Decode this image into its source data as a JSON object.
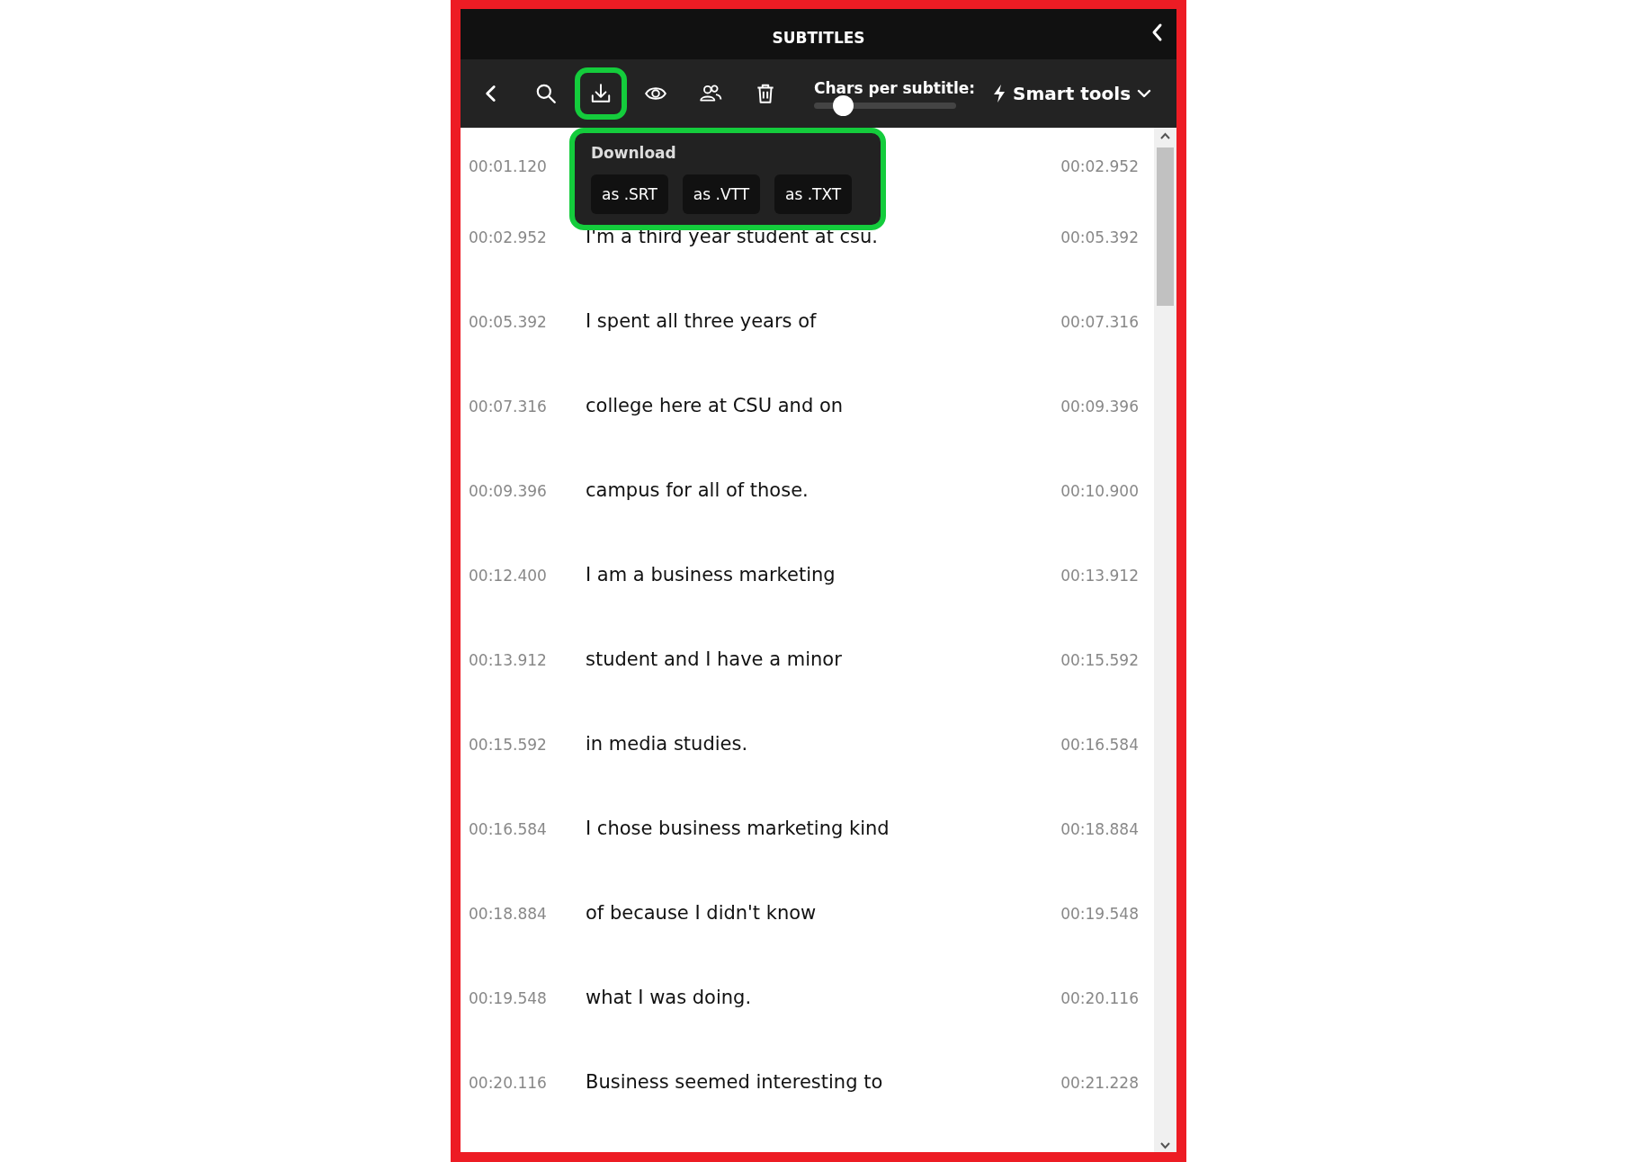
{
  "panel": {
    "title": "SUBTITLES"
  },
  "toolbar": {
    "tools": [
      {
        "kind": "back",
        "selected": false
      },
      {
        "kind": "search",
        "selected": false
      },
      {
        "kind": "download",
        "selected": true
      },
      {
        "kind": "eye",
        "selected": false
      },
      {
        "kind": "people",
        "selected": false
      },
      {
        "kind": "trash",
        "selected": false
      }
    ],
    "chars_per_subtitle": {
      "label": "Chars per subtitle:",
      "level": 0.2
    },
    "smart_tools": {
      "label": "Smart tools"
    }
  },
  "download_menu": {
    "title": "Download",
    "options": [
      "as .SRT",
      "as .VTT",
      "as .TXT"
    ]
  },
  "rows": [
    {
      "start": "00:01.120",
      "end": "00:02.952"
    },
    {
      "start": "00:02.952",
      "text": "I'm a third year student at csu.",
      "end": "00:05.392"
    },
    {
      "start": "00:05.392",
      "text": "I spent all three years of",
      "end": "00:07.316"
    },
    {
      "start": "00:07.316",
      "text": "college here at CSU and on",
      "end": "00:09.396"
    },
    {
      "start": "00:09.396",
      "text": "campus for all of those.",
      "end": "00:10.900"
    },
    {
      "start": "00:12.400",
      "text": "I am a business marketing",
      "end": "00:13.912"
    },
    {
      "start": "00:13.912",
      "text": "student and I have a minor",
      "end": "00:15.592"
    },
    {
      "start": "00:15.592",
      "text": "in media studies.",
      "end": "00:16.584"
    },
    {
      "start": "00:16.584",
      "text": "I chose business marketing kind",
      "end": "00:18.884"
    },
    {
      "start": "00:18.884",
      "text": "of because I didn't know",
      "end": "00:19.548"
    },
    {
      "start": "00:19.548",
      "text": "what I was doing.",
      "end": "00:20.116"
    },
    {
      "start": "00:20.116",
      "text": "Business seemed interesting to",
      "end": "00:21.228"
    }
  ]
}
